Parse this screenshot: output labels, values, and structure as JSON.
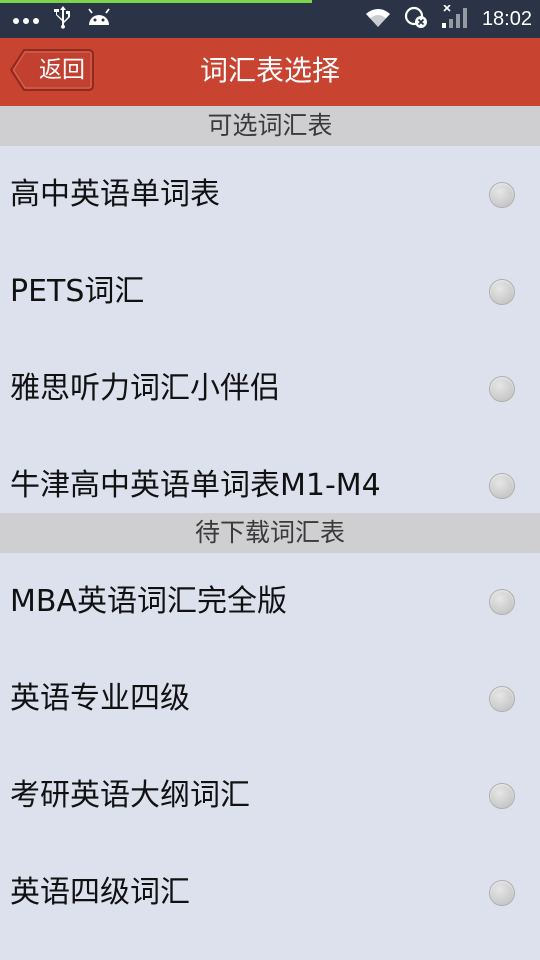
{
  "status_bar": {
    "time": "18:02",
    "left_icons": [
      "more-dots-icon",
      "usb-icon",
      "android-icon"
    ],
    "right_icons": [
      "wifi-icon",
      "sync-off-icon",
      "signal-icon"
    ]
  },
  "header": {
    "back_label": "返回",
    "title": "词汇表选择"
  },
  "sections": {
    "available": {
      "title": "可选词汇表",
      "items": [
        {
          "label": "高中英语单词表",
          "selected": false
        },
        {
          "label": "PETS词汇",
          "selected": false
        },
        {
          "label": "雅思听力词汇小伴侣",
          "selected": false
        },
        {
          "label": "牛津高中英语单词表M1-M4",
          "selected": false
        }
      ]
    },
    "to_download": {
      "title": "待下载词汇表",
      "items": [
        {
          "label": "MBA英语词汇完全版",
          "selected": false
        },
        {
          "label": "英语专业四级",
          "selected": false
        },
        {
          "label": "考研英语大纲词汇",
          "selected": false
        },
        {
          "label": "英语四级词汇",
          "selected": false
        }
      ]
    }
  },
  "colors": {
    "title_bar": "#c94331",
    "status_bar": "#2b3447",
    "background": "#dde1ee",
    "section_header": "#cfcfd1"
  }
}
